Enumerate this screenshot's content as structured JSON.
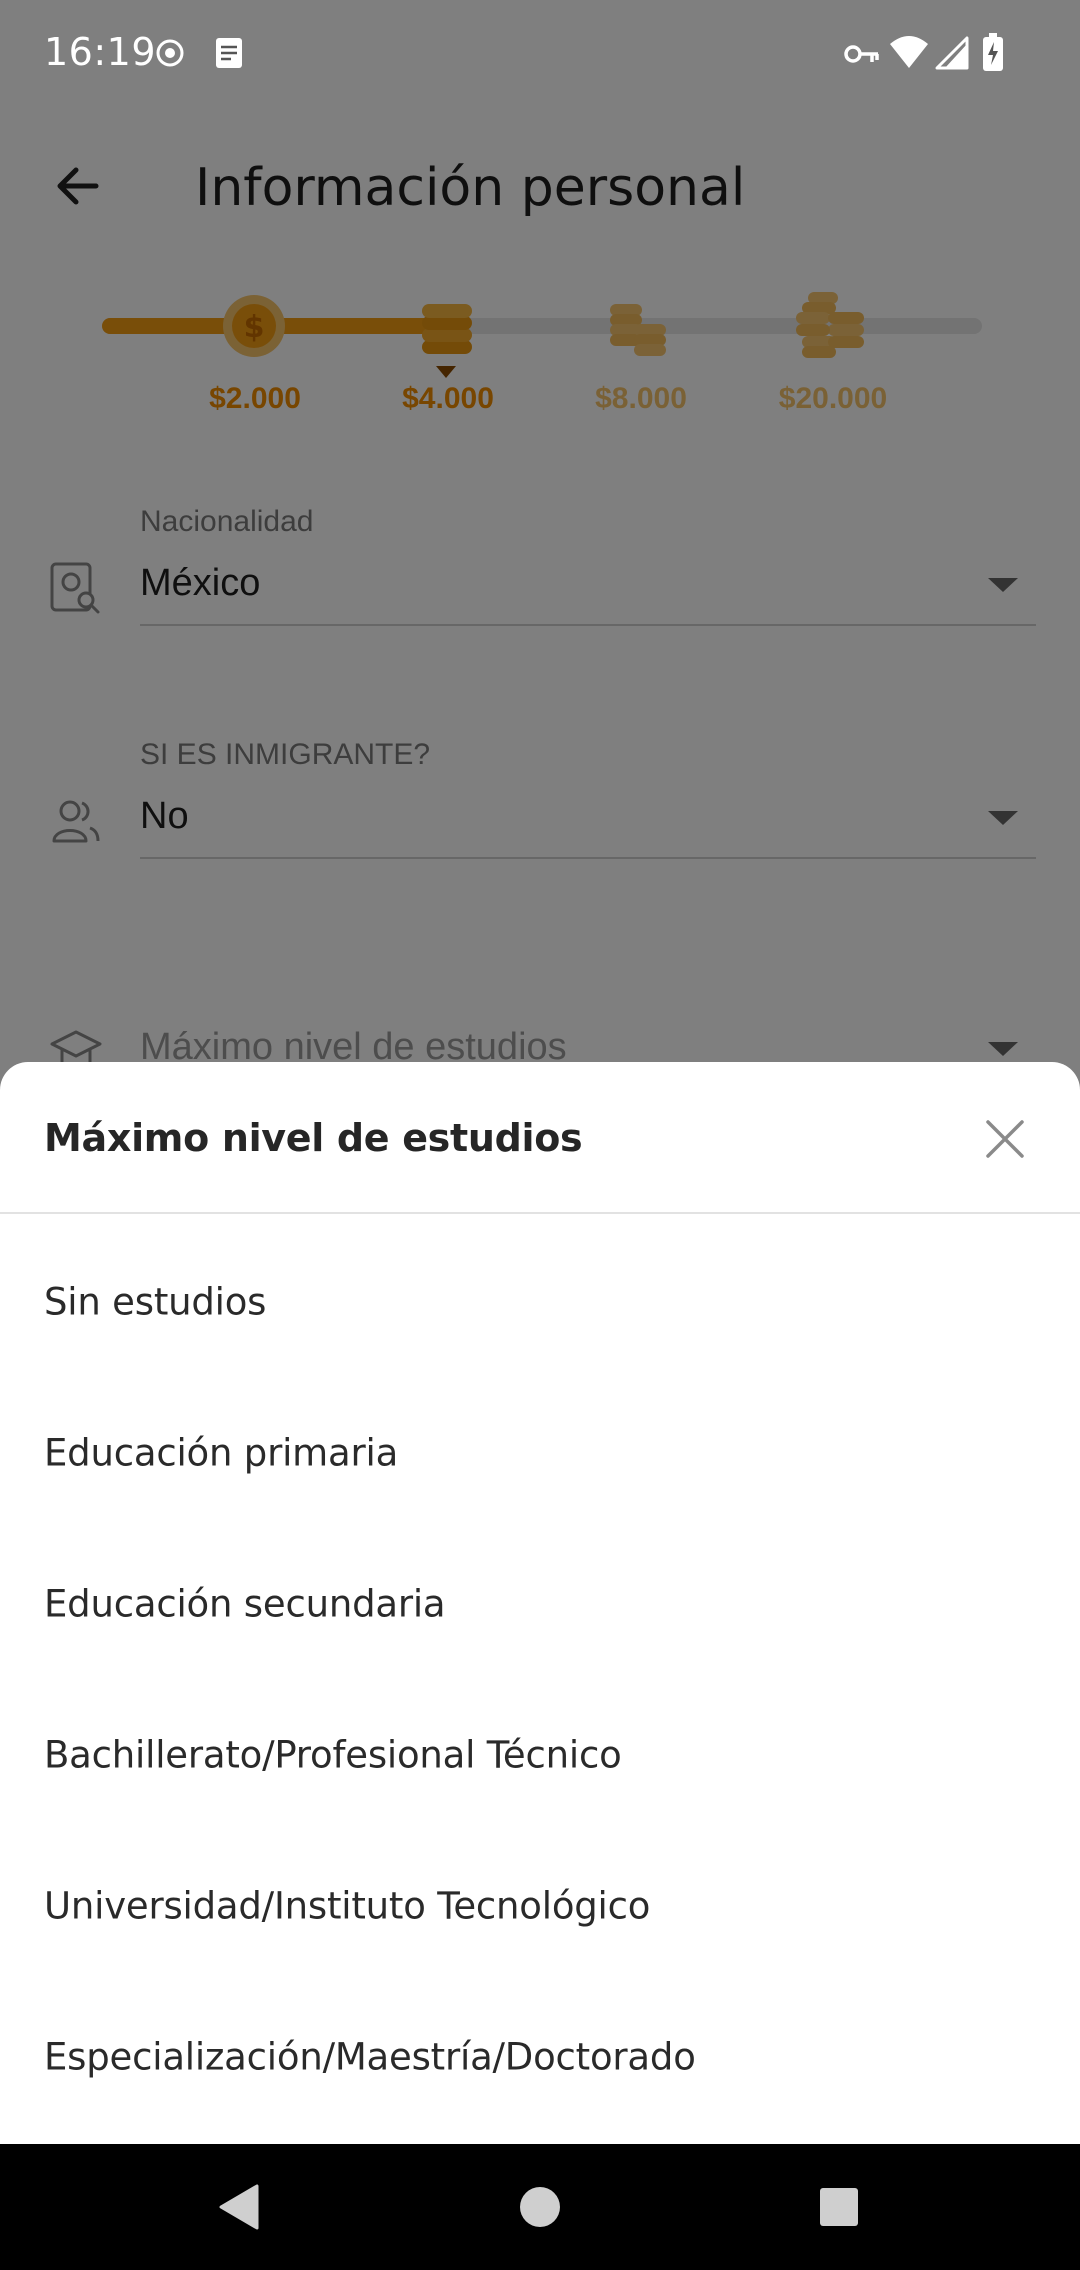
{
  "status_bar": {
    "time": "16:19",
    "icons": [
      "record-icon",
      "notes-icon",
      "vpn-key-icon",
      "wifi-icon",
      "signal-icon",
      "battery-charging-icon"
    ]
  },
  "app_bar": {
    "title": "Información personal",
    "back_icon": "arrow-back-icon"
  },
  "loan_progress": {
    "steps": [
      {
        "label": "$2.000",
        "state": "completed",
        "icon": "coin-dollar-icon"
      },
      {
        "label": "$4.000",
        "state": "current",
        "icon": "coin-stack-icon"
      },
      {
        "label": "$8.000",
        "state": "locked",
        "icon": "coin-stacks-icon"
      },
      {
        "label": "$20.000",
        "state": "locked",
        "icon": "coin-pile-icon"
      }
    ],
    "accent_color": "#f39c12",
    "locked_color": "#f5c26b"
  },
  "form": {
    "nationality": {
      "label": "Nacionalidad",
      "value": "México",
      "icon": "passport-search-icon"
    },
    "immigrant": {
      "label": "SI ES INMIGRANTE?",
      "value": "No",
      "icon": "people-icon"
    },
    "education": {
      "placeholder": "Máximo nivel de estudios",
      "icon": "graduation-cap-icon"
    }
  },
  "sheet": {
    "title": "Máximo nivel de estudios",
    "close_icon": "close-icon",
    "options": [
      "Sin estudios",
      "Educación primaria",
      "Educación secundaria",
      "Bachillerato/Profesional Técnico",
      "Universidad/Instituto Tecnológico",
      "Especialización/Maestría/Doctorado"
    ]
  },
  "nav_bar": {
    "buttons": [
      "back-triangle-icon",
      "home-circle-icon",
      "recents-square-icon"
    ]
  }
}
